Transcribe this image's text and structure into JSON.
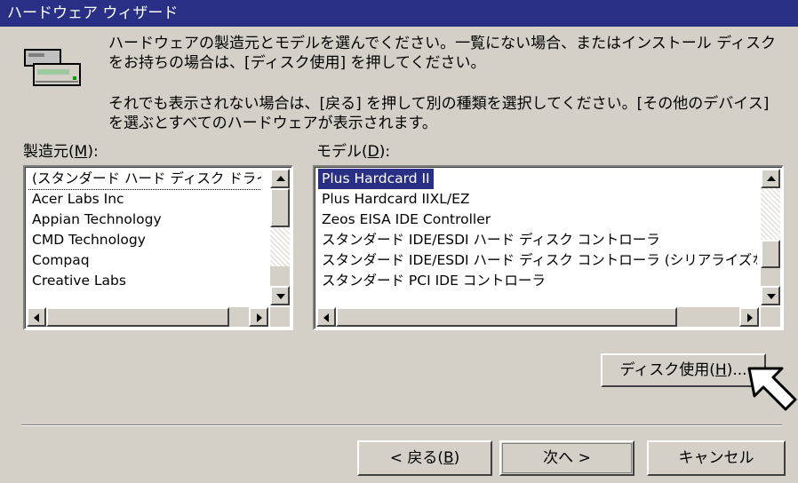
{
  "window": {
    "title": "ハードウェア ウィザード"
  },
  "description": {
    "line1": "ハードウェアの製造元とモデルを選んでください。一覧にない場合、またはインストール ディスクをお持ちの場合は、[ディスク使用] を押してください。",
    "line2": "それでも表示されない場合は、[戻る] を押して別の種類を選択してください。[その他のデバイス] を選ぶとすべてのハードウェアが表示されます。"
  },
  "manufacturer": {
    "label_pre": "製造元(",
    "label_key": "M",
    "label_post": "):",
    "items": [
      "(スタンダード ハード ディスク ドライバ)",
      "Acer Labs Inc",
      "Appian Technology",
      "CMD Technology",
      "Compaq",
      "Creative Labs"
    ]
  },
  "model": {
    "label_pre": "モデル(",
    "label_key": "D",
    "label_post": "):",
    "items": [
      "Plus Hardcard II",
      "Plus Hardcard IIXL/EZ",
      "Zeos EISA IDE Controller",
      "スタンダード IDE/ESDI ハード ディスク コントローラ",
      "スタンダード IDE/ESDI ハード ディスク コントローラ (シリアライズなし)",
      "スタンダード PCI IDE コントローラ"
    ]
  },
  "buttons": {
    "disk_pre": "ディスク使用(",
    "disk_key": "H",
    "disk_post": ")...",
    "back_pre": "< 戻る(",
    "back_key": "B",
    "back_post": ")",
    "next": "次へ >",
    "cancel": "キャンセル"
  },
  "colors": {
    "titlebar": "#2a2f86",
    "face": "#d4d0c8",
    "selection": "#2a2f86"
  }
}
